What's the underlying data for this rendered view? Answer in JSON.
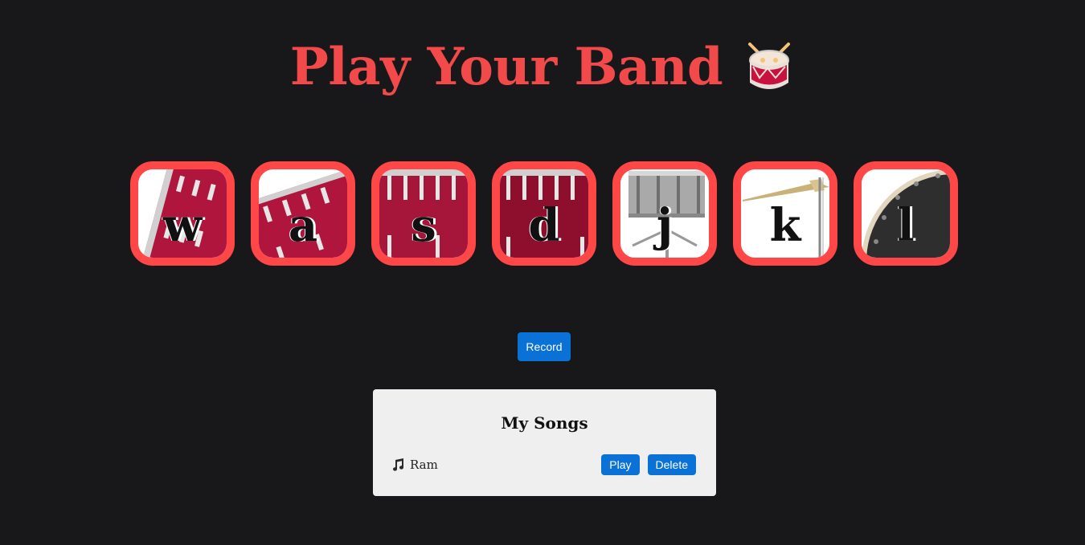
{
  "header": {
    "title": "Play Your Band",
    "icon": "drum-emoji-icon"
  },
  "drums": [
    {
      "key": "w",
      "icon": "red-tom-drum-icon"
    },
    {
      "key": "a",
      "icon": "red-tom-drum-icon"
    },
    {
      "key": "s",
      "icon": "red-bass-drum-icon"
    },
    {
      "key": "d",
      "icon": "red-bass-drum-icon"
    },
    {
      "key": "j",
      "icon": "snare-drum-icon"
    },
    {
      "key": "k",
      "icon": "cymbal-icon"
    },
    {
      "key": "l",
      "icon": "floor-drum-icon"
    }
  ],
  "controls": {
    "record_label": "Record"
  },
  "songs": {
    "title": "My Songs",
    "items": [
      {
        "name": "Ram",
        "play_label": "Play",
        "delete_label": "Delete"
      }
    ]
  },
  "colors": {
    "background": "#18181a",
    "accent": "#ff4747",
    "button": "#0a72d6",
    "panel": "#efefef"
  }
}
